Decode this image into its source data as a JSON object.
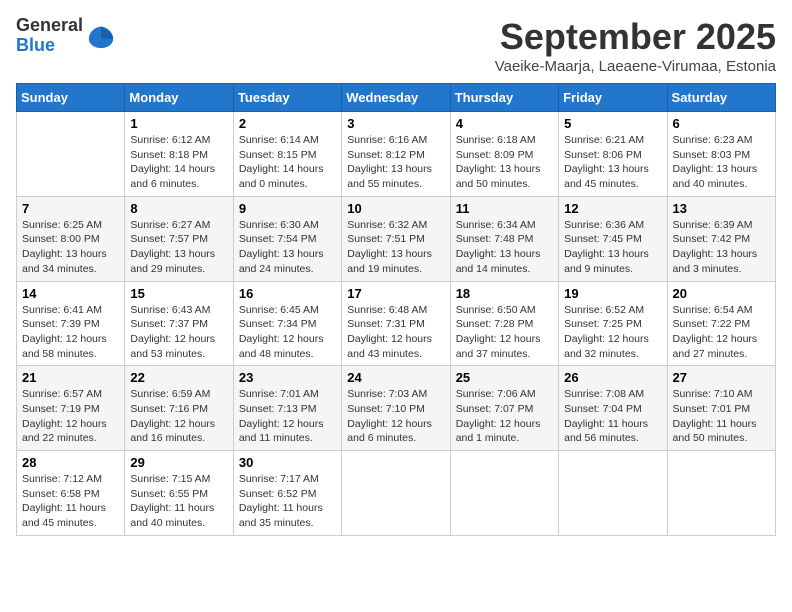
{
  "logo": {
    "general": "General",
    "blue": "Blue"
  },
  "header": {
    "month": "September 2025",
    "location": "Vaeike-Maarja, Laeaene-Virumaa, Estonia"
  },
  "weekdays": [
    "Sunday",
    "Monday",
    "Tuesday",
    "Wednesday",
    "Thursday",
    "Friday",
    "Saturday"
  ],
  "weeks": [
    [
      {
        "day": "",
        "sunrise": "",
        "sunset": "",
        "daylight": ""
      },
      {
        "day": "1",
        "sunrise": "Sunrise: 6:12 AM",
        "sunset": "Sunset: 8:18 PM",
        "daylight": "Daylight: 14 hours and 6 minutes."
      },
      {
        "day": "2",
        "sunrise": "Sunrise: 6:14 AM",
        "sunset": "Sunset: 8:15 PM",
        "daylight": "Daylight: 14 hours and 0 minutes."
      },
      {
        "day": "3",
        "sunrise": "Sunrise: 6:16 AM",
        "sunset": "Sunset: 8:12 PM",
        "daylight": "Daylight: 13 hours and 55 minutes."
      },
      {
        "day": "4",
        "sunrise": "Sunrise: 6:18 AM",
        "sunset": "Sunset: 8:09 PM",
        "daylight": "Daylight: 13 hours and 50 minutes."
      },
      {
        "day": "5",
        "sunrise": "Sunrise: 6:21 AM",
        "sunset": "Sunset: 8:06 PM",
        "daylight": "Daylight: 13 hours and 45 minutes."
      },
      {
        "day": "6",
        "sunrise": "Sunrise: 6:23 AM",
        "sunset": "Sunset: 8:03 PM",
        "daylight": "Daylight: 13 hours and 40 minutes."
      }
    ],
    [
      {
        "day": "7",
        "sunrise": "Sunrise: 6:25 AM",
        "sunset": "Sunset: 8:00 PM",
        "daylight": "Daylight: 13 hours and 34 minutes."
      },
      {
        "day": "8",
        "sunrise": "Sunrise: 6:27 AM",
        "sunset": "Sunset: 7:57 PM",
        "daylight": "Daylight: 13 hours and 29 minutes."
      },
      {
        "day": "9",
        "sunrise": "Sunrise: 6:30 AM",
        "sunset": "Sunset: 7:54 PM",
        "daylight": "Daylight: 13 hours and 24 minutes."
      },
      {
        "day": "10",
        "sunrise": "Sunrise: 6:32 AM",
        "sunset": "Sunset: 7:51 PM",
        "daylight": "Daylight: 13 hours and 19 minutes."
      },
      {
        "day": "11",
        "sunrise": "Sunrise: 6:34 AM",
        "sunset": "Sunset: 7:48 PM",
        "daylight": "Daylight: 13 hours and 14 minutes."
      },
      {
        "day": "12",
        "sunrise": "Sunrise: 6:36 AM",
        "sunset": "Sunset: 7:45 PM",
        "daylight": "Daylight: 13 hours and 9 minutes."
      },
      {
        "day": "13",
        "sunrise": "Sunrise: 6:39 AM",
        "sunset": "Sunset: 7:42 PM",
        "daylight": "Daylight: 13 hours and 3 minutes."
      }
    ],
    [
      {
        "day": "14",
        "sunrise": "Sunrise: 6:41 AM",
        "sunset": "Sunset: 7:39 PM",
        "daylight": "Daylight: 12 hours and 58 minutes."
      },
      {
        "day": "15",
        "sunrise": "Sunrise: 6:43 AM",
        "sunset": "Sunset: 7:37 PM",
        "daylight": "Daylight: 12 hours and 53 minutes."
      },
      {
        "day": "16",
        "sunrise": "Sunrise: 6:45 AM",
        "sunset": "Sunset: 7:34 PM",
        "daylight": "Daylight: 12 hours and 48 minutes."
      },
      {
        "day": "17",
        "sunrise": "Sunrise: 6:48 AM",
        "sunset": "Sunset: 7:31 PM",
        "daylight": "Daylight: 12 hours and 43 minutes."
      },
      {
        "day": "18",
        "sunrise": "Sunrise: 6:50 AM",
        "sunset": "Sunset: 7:28 PM",
        "daylight": "Daylight: 12 hours and 37 minutes."
      },
      {
        "day": "19",
        "sunrise": "Sunrise: 6:52 AM",
        "sunset": "Sunset: 7:25 PM",
        "daylight": "Daylight: 12 hours and 32 minutes."
      },
      {
        "day": "20",
        "sunrise": "Sunrise: 6:54 AM",
        "sunset": "Sunset: 7:22 PM",
        "daylight": "Daylight: 12 hours and 27 minutes."
      }
    ],
    [
      {
        "day": "21",
        "sunrise": "Sunrise: 6:57 AM",
        "sunset": "Sunset: 7:19 PM",
        "daylight": "Daylight: 12 hours and 22 minutes."
      },
      {
        "day": "22",
        "sunrise": "Sunrise: 6:59 AM",
        "sunset": "Sunset: 7:16 PM",
        "daylight": "Daylight: 12 hours and 16 minutes."
      },
      {
        "day": "23",
        "sunrise": "Sunrise: 7:01 AM",
        "sunset": "Sunset: 7:13 PM",
        "daylight": "Daylight: 12 hours and 11 minutes."
      },
      {
        "day": "24",
        "sunrise": "Sunrise: 7:03 AM",
        "sunset": "Sunset: 7:10 PM",
        "daylight": "Daylight: 12 hours and 6 minutes."
      },
      {
        "day": "25",
        "sunrise": "Sunrise: 7:06 AM",
        "sunset": "Sunset: 7:07 PM",
        "daylight": "Daylight: 12 hours and 1 minute."
      },
      {
        "day": "26",
        "sunrise": "Sunrise: 7:08 AM",
        "sunset": "Sunset: 7:04 PM",
        "daylight": "Daylight: 11 hours and 56 minutes."
      },
      {
        "day": "27",
        "sunrise": "Sunrise: 7:10 AM",
        "sunset": "Sunset: 7:01 PM",
        "daylight": "Daylight: 11 hours and 50 minutes."
      }
    ],
    [
      {
        "day": "28",
        "sunrise": "Sunrise: 7:12 AM",
        "sunset": "Sunset: 6:58 PM",
        "daylight": "Daylight: 11 hours and 45 minutes."
      },
      {
        "day": "29",
        "sunrise": "Sunrise: 7:15 AM",
        "sunset": "Sunset: 6:55 PM",
        "daylight": "Daylight: 11 hours and 40 minutes."
      },
      {
        "day": "30",
        "sunrise": "Sunrise: 7:17 AM",
        "sunset": "Sunset: 6:52 PM",
        "daylight": "Daylight: 11 hours and 35 minutes."
      },
      {
        "day": "",
        "sunrise": "",
        "sunset": "",
        "daylight": ""
      },
      {
        "day": "",
        "sunrise": "",
        "sunset": "",
        "daylight": ""
      },
      {
        "day": "",
        "sunrise": "",
        "sunset": "",
        "daylight": ""
      },
      {
        "day": "",
        "sunrise": "",
        "sunset": "",
        "daylight": ""
      }
    ]
  ]
}
